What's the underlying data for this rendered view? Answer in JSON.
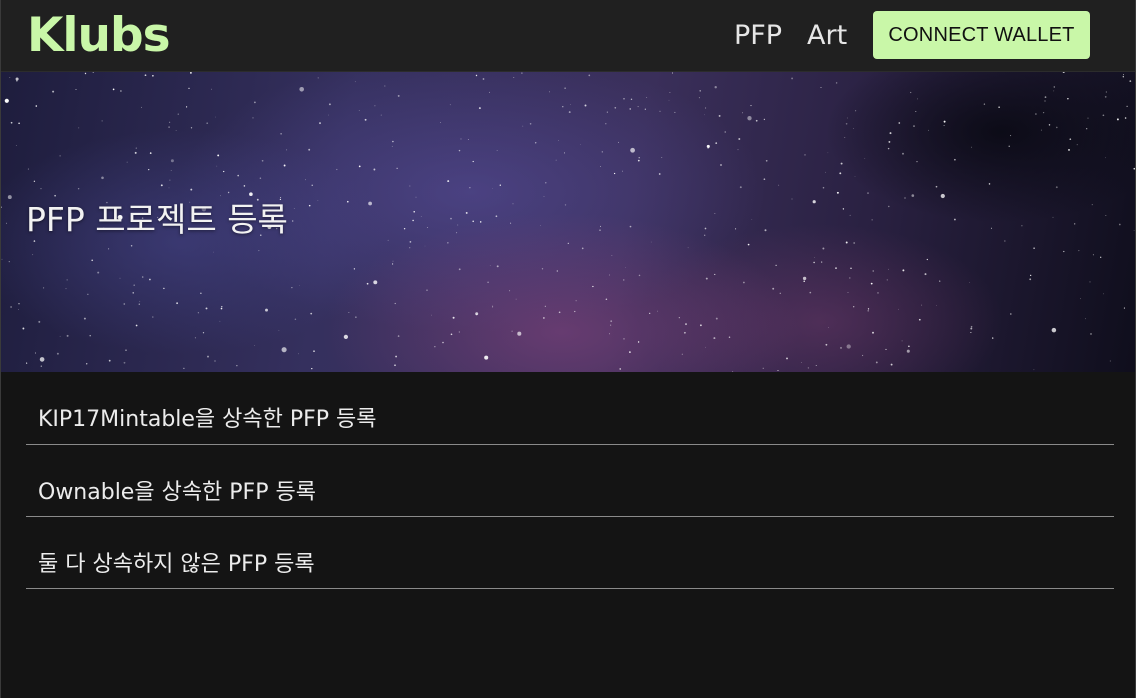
{
  "colors": {
    "accent": "#c9f7a8",
    "background": "#141414",
    "header_background": "#202020",
    "text": "#ececec"
  },
  "header": {
    "logo": "Klubs",
    "nav": [
      {
        "label": "PFP"
      },
      {
        "label": "Art"
      }
    ],
    "connect_button_label": "CONNECT WALLET"
  },
  "banner": {
    "title": "PFP 프로젝트 등록",
    "image": "starry-night-sky"
  },
  "options": [
    {
      "label": "KIP17Mintable을 상속한 PFP 등록"
    },
    {
      "label": "Ownable을 상속한 PFP 등록"
    },
    {
      "label": "둘 다 상속하지 않은 PFP 등록"
    }
  ]
}
